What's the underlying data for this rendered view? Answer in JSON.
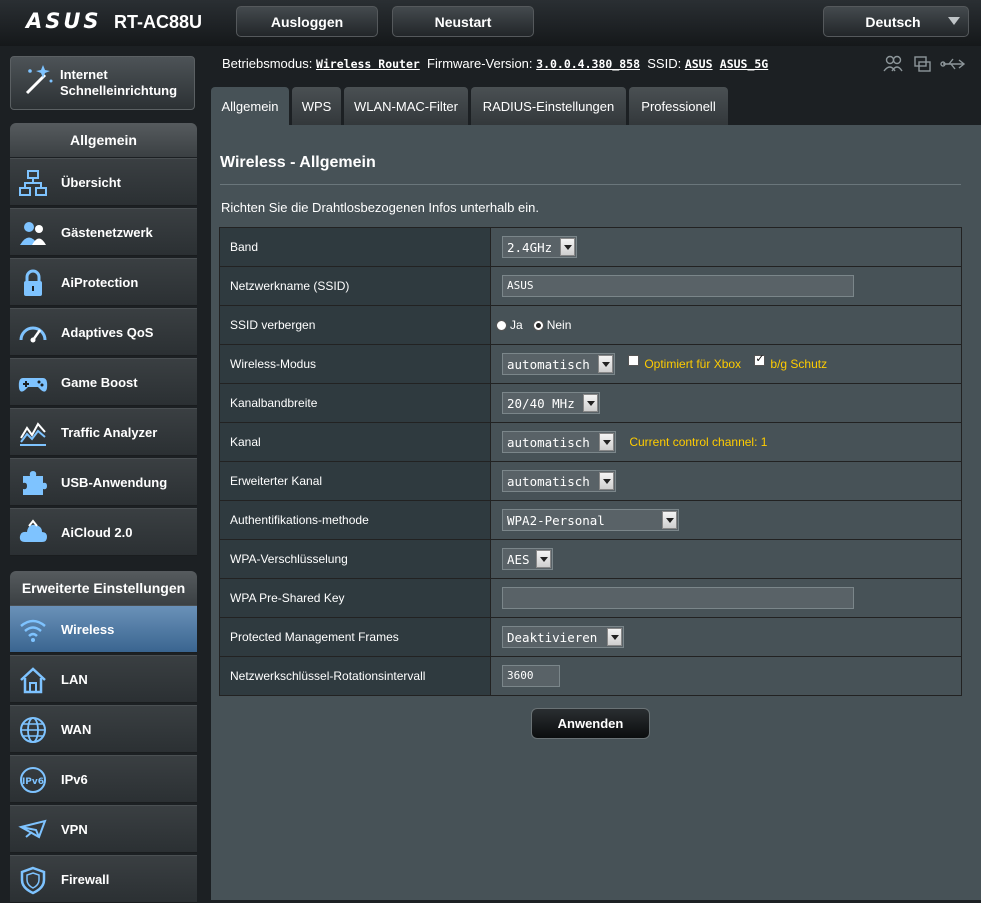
{
  "header": {
    "brand": "ASUS",
    "model": "RT-AC88U",
    "logout_label": "Ausloggen",
    "reboot_label": "Neustart",
    "language": "Deutsch"
  },
  "status": {
    "mode_label": "Betriebsmodus:",
    "mode_value": "Wireless Router",
    "firmware_label": "Firmware-Version:",
    "firmware_value": "3.0.0.4.380_858",
    "ssid_label": "SSID:",
    "ssid_1": "ASUS",
    "ssid_2": "ASUS_5G"
  },
  "sidebar": {
    "quick_setup_line1": "Internet",
    "quick_setup_line2": "Schnelleinrichtung",
    "general_header": "Allgemein",
    "general_items": [
      {
        "label": "Übersicht",
        "icon": "network-map-icon"
      },
      {
        "label": "Gästenetzwerk",
        "icon": "guest-network-icon"
      },
      {
        "label": "AiProtection",
        "icon": "lock-icon"
      },
      {
        "label": "Adaptives QoS",
        "icon": "speedometer-icon"
      },
      {
        "label": "Game Boost",
        "icon": "gamepad-icon"
      },
      {
        "label": "Traffic Analyzer",
        "icon": "traffic-chart-icon"
      },
      {
        "label": "USB-Anwendung",
        "icon": "puzzle-icon"
      },
      {
        "label": "AiCloud 2.0",
        "icon": "cloud-icon"
      }
    ],
    "advanced_header": "Erweiterte Einstellungen",
    "advanced_items": [
      {
        "label": "Wireless",
        "icon": "wifi-icon",
        "active": true
      },
      {
        "label": "LAN",
        "icon": "home-icon"
      },
      {
        "label": "WAN",
        "icon": "globe-icon"
      },
      {
        "label": "IPv6",
        "icon": "ipv6-icon"
      },
      {
        "label": "VPN",
        "icon": "vpn-icon"
      },
      {
        "label": "Firewall",
        "icon": "shield-icon"
      }
    ]
  },
  "tabs": [
    "Allgemein",
    "WPS",
    "WLAN-MAC-Filter",
    "RADIUS-Einstellungen",
    "Professionell"
  ],
  "panel": {
    "title": "Wireless - Allgemein",
    "description": "Richten Sie die Drahtlosbezogenen Infos unterhalb ein."
  },
  "form": {
    "band_label": "Band",
    "band_value": "2.4GHz",
    "ssid_label": "Netzwerkname (SSID)",
    "ssid_value": "ASUS",
    "hide_ssid_label": "SSID verbergen",
    "hide_yes": "Ja",
    "hide_no": "Nein",
    "mode_label": "Wireless-Modus",
    "mode_value": "automatisch",
    "xbox_label": "Optimiert für Xbox",
    "bg_label": "b/g Schutz",
    "bandwidth_label": "Kanalbandbreite",
    "bandwidth_value": "20/40 MHz",
    "channel_label": "Kanal",
    "channel_value": "automatisch",
    "channel_hint": "Current control channel: 1",
    "ext_channel_label": "Erweiterter Kanal",
    "ext_channel_value": "automatisch",
    "auth_label": "Authentifikations-methode",
    "auth_value": "WPA2-Personal",
    "enc_label": "WPA-Verschlüsselung",
    "enc_value": "AES",
    "psk_label": "WPA Pre-Shared Key",
    "psk_value": "",
    "pmf_label": "Protected Management Frames",
    "pmf_value": "Deaktivieren",
    "rotation_label": "Netzwerkschlüssel-Rotationsintervall",
    "rotation_value": "3600"
  },
  "apply_label": "Anwenden"
}
